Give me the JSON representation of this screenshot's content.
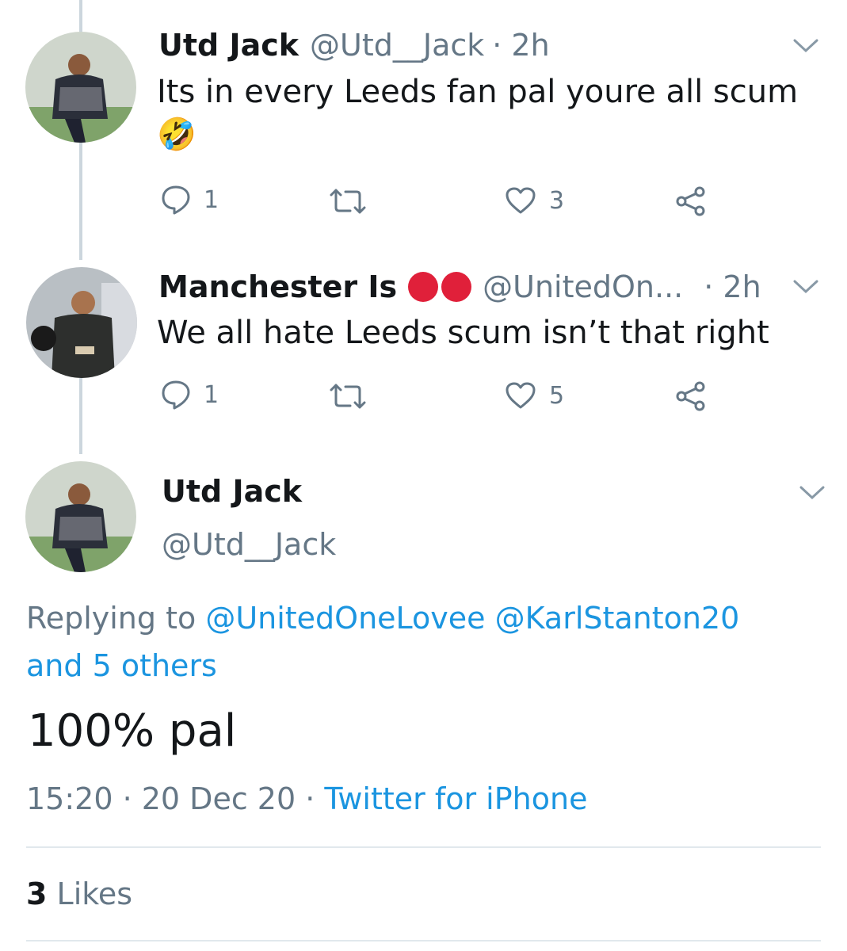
{
  "colors": {
    "accent": "#1b95e0",
    "muted": "#657786",
    "text": "#14171a",
    "red_dot": "#e0203a"
  },
  "tweet1": {
    "name": "Utd Jack",
    "handle": "@Utd__Jack",
    "time": "· 2h",
    "text": "Its in every Leeds fan pal youre all scum",
    "emoji": "🤣",
    "replies": "1",
    "retweets": "",
    "likes": "3"
  },
  "tweet2": {
    "name": "Manchester Is",
    "handle": "@UnitedOn...",
    "time": "· 2h",
    "text": "We all hate Leeds scum isn’t that right",
    "replies": "1",
    "retweets": "",
    "likes": "5"
  },
  "main": {
    "name": "Utd Jack",
    "handle": "@Utd__Jack",
    "replying_prefix": "Replying to",
    "reply_mention_1": "@UnitedOneLovee",
    "reply_mention_2": "@KarlStanton20",
    "reply_others": "and 5 others",
    "text": "100% pal",
    "timestamp": "15:20 · 20 Dec 20 ·",
    "source": "Twitter for iPhone",
    "likes_count": "3",
    "likes_label": "Likes"
  },
  "icons": {
    "reply": "reply-icon",
    "retweet": "retweet-icon",
    "like": "heart-icon",
    "share": "share-icon",
    "menu": "chevron-down-icon"
  }
}
